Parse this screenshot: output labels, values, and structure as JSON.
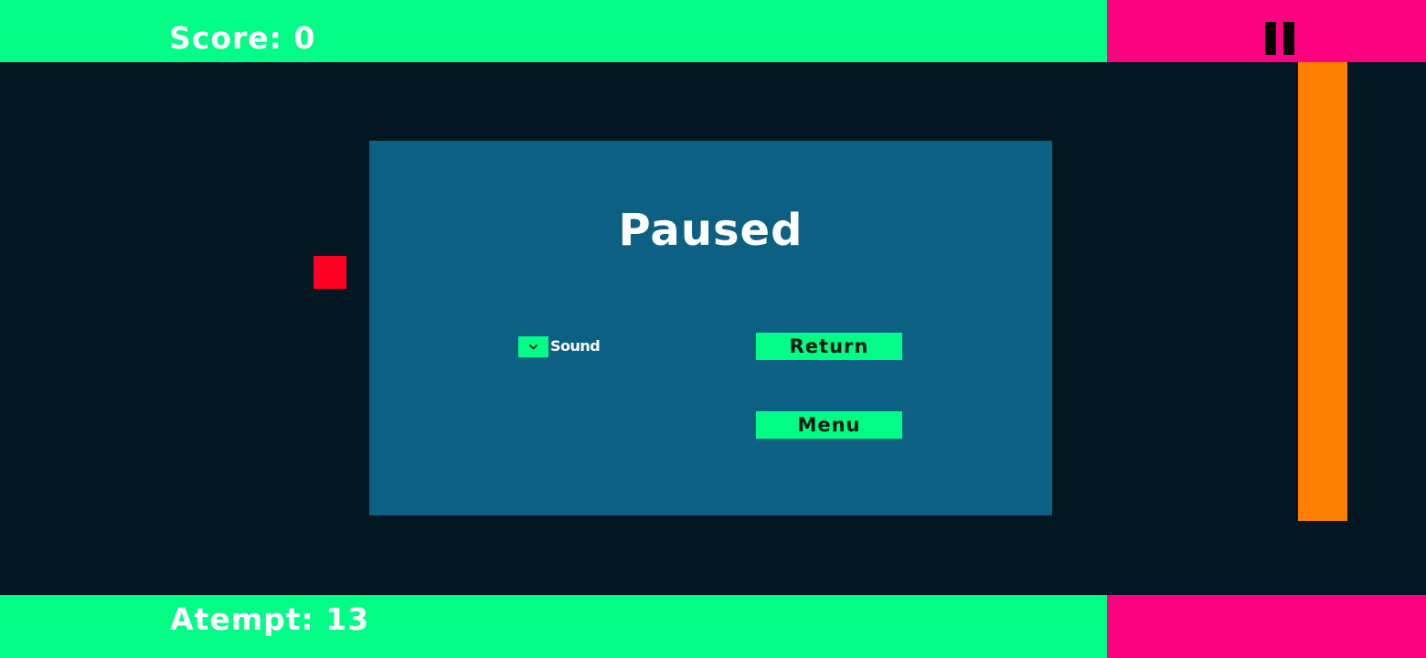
{
  "hud": {
    "score_label": "Score: 0",
    "attempt_label": "Atempt: 13"
  },
  "pause_menu": {
    "title": "Paused",
    "sound_label": "Sound",
    "sound_enabled": true,
    "return_label": "Return",
    "menu_label": "Menu"
  },
  "icons": {
    "pause": "pause-icon",
    "sound_check": "check-icon"
  },
  "colors": {
    "background": "#021722",
    "hud_green": "#00fe86",
    "hud_pink": "#ff0080",
    "panel": "#0b6083",
    "obstacle": "#ff8000",
    "player": "#ff0022"
  }
}
